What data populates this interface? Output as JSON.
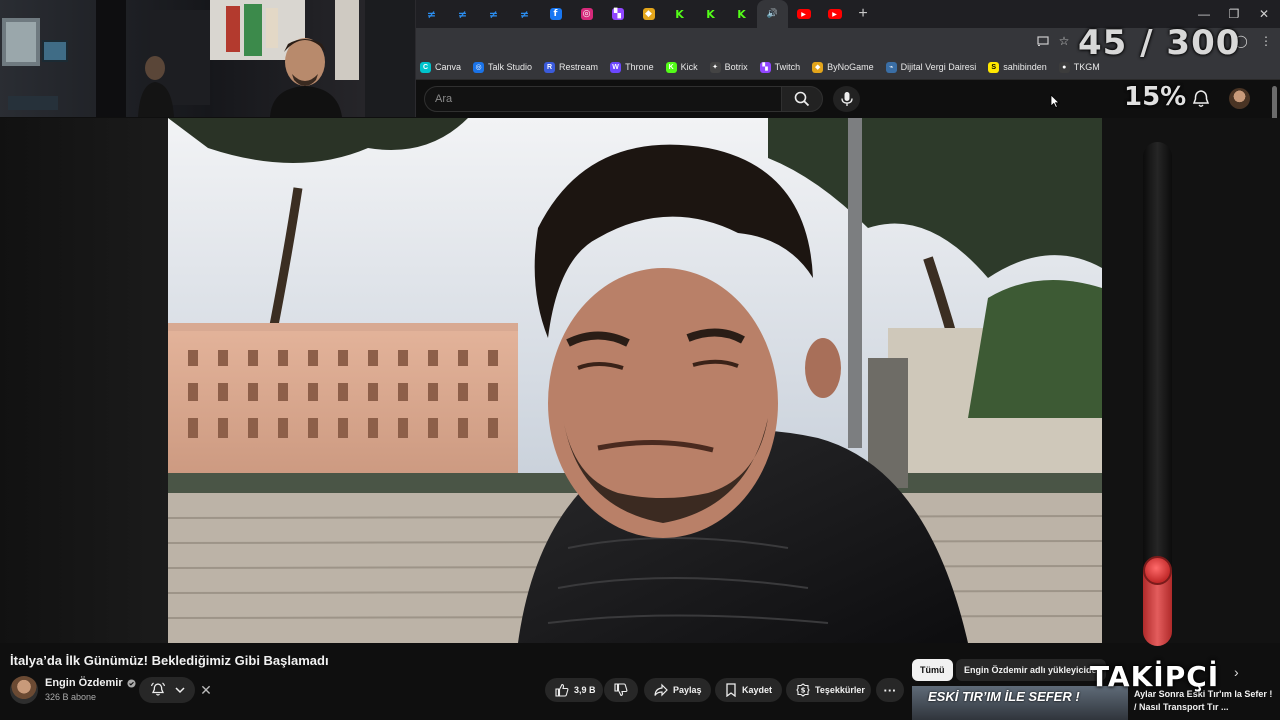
{
  "browser": {
    "tabs": [
      {
        "icon": "streamdeck-icon",
        "color": "#2b8ef0",
        "glyph": "≠"
      },
      {
        "icon": "streamdeck-icon",
        "color": "#2b8ef0",
        "glyph": "≠"
      },
      {
        "icon": "streamdeck-icon",
        "color": "#2b8ef0",
        "glyph": "≠"
      },
      {
        "icon": "streamdeck-icon",
        "color": "#2b8ef0",
        "glyph": "≠"
      },
      {
        "icon": "facebook-icon",
        "color": "#1877f2",
        "glyph": "f"
      },
      {
        "icon": "instagram-icon",
        "color": "#d6297a",
        "glyph": "◎"
      },
      {
        "icon": "twitch-icon",
        "color": "#9146ff",
        "glyph": "▚"
      },
      {
        "icon": "bynogame-icon",
        "color": "#e3a51b",
        "glyph": "◆"
      },
      {
        "icon": "kick-icon",
        "color": "#53fc18",
        "glyph": "K"
      },
      {
        "icon": "kick-icon",
        "color": "#53fc18",
        "glyph": "K"
      },
      {
        "icon": "kick-icon",
        "color": "#53fc18",
        "glyph": "K"
      },
      {
        "icon": "audio-tab-icon",
        "color": "#5f6368",
        "glyph": "🔊",
        "active": true
      },
      {
        "icon": "youtube-icon",
        "color": "#ff0000",
        "glyph": "▶"
      },
      {
        "icon": "youtube-icon",
        "color": "#ff0000",
        "glyph": "▶"
      }
    ],
    "bookmarks": [
      {
        "label": "Canva",
        "icon": "canva-icon",
        "color": "#00c4cc",
        "glyph": "C"
      },
      {
        "label": "Talk Studio",
        "icon": "talkstudio-icon",
        "color": "#1a73e8",
        "glyph": "◎"
      },
      {
        "label": "Restream",
        "icon": "restream-icon",
        "color": "#3b5bdb",
        "glyph": "R"
      },
      {
        "label": "Throne",
        "icon": "throne-icon",
        "color": "#6c47ff",
        "glyph": "W"
      },
      {
        "label": "Kick",
        "icon": "kick-icon",
        "color": "#53fc18",
        "glyph": "K"
      },
      {
        "label": "Botrix",
        "icon": "botrix-icon",
        "color": "#444",
        "glyph": "✦"
      },
      {
        "label": "Twitch",
        "icon": "twitch-icon",
        "color": "#9146ff",
        "glyph": "▚"
      },
      {
        "label": "ByNoGame",
        "icon": "bynogame-icon",
        "color": "#e3a51b",
        "glyph": "◆"
      },
      {
        "label": "Dijital Vergi Dairesi",
        "icon": "gib-icon",
        "color": "#3a6ea5",
        "glyph": "⌁"
      },
      {
        "label": "sahibinden",
        "icon": "sahibinden-icon",
        "color": "#ffe800",
        "glyph": "S"
      },
      {
        "label": "TKGM",
        "icon": "map-pin-icon",
        "color": "#3c3c3c",
        "glyph": "●"
      }
    ]
  },
  "youtube": {
    "search_placeholder": "Ara",
    "video": {
      "title": "İtalya’da İlk Günümüz! Beklediğimiz Gibi Başlamadı",
      "channel": "Engin Özdemir",
      "subscribers": "326 B abone",
      "likes": "3,9 B",
      "share_label": "Paylaş",
      "save_label": "Kaydet",
      "thanks_label": "Teşekkürler"
    },
    "chips": {
      "all": "Tümü",
      "uploader": "Engin Özdemir adlı yükleyiciden"
    },
    "recommendation": {
      "thumb_text": "ESKİ TIR’IM İLE SEFER !",
      "title": "Aylar Sonra Eski Tır'ım la Sefer ! / Nasıl Transport Tır ..."
    }
  },
  "stream_overlay": {
    "goal_current": "45",
    "goal_target": "300",
    "goal_text": "45 / 300",
    "goal_percent_text": "15%",
    "goal_fraction": 0.15,
    "follower_label": "TAKİPÇİ",
    "accent_color": "#e04646"
  }
}
